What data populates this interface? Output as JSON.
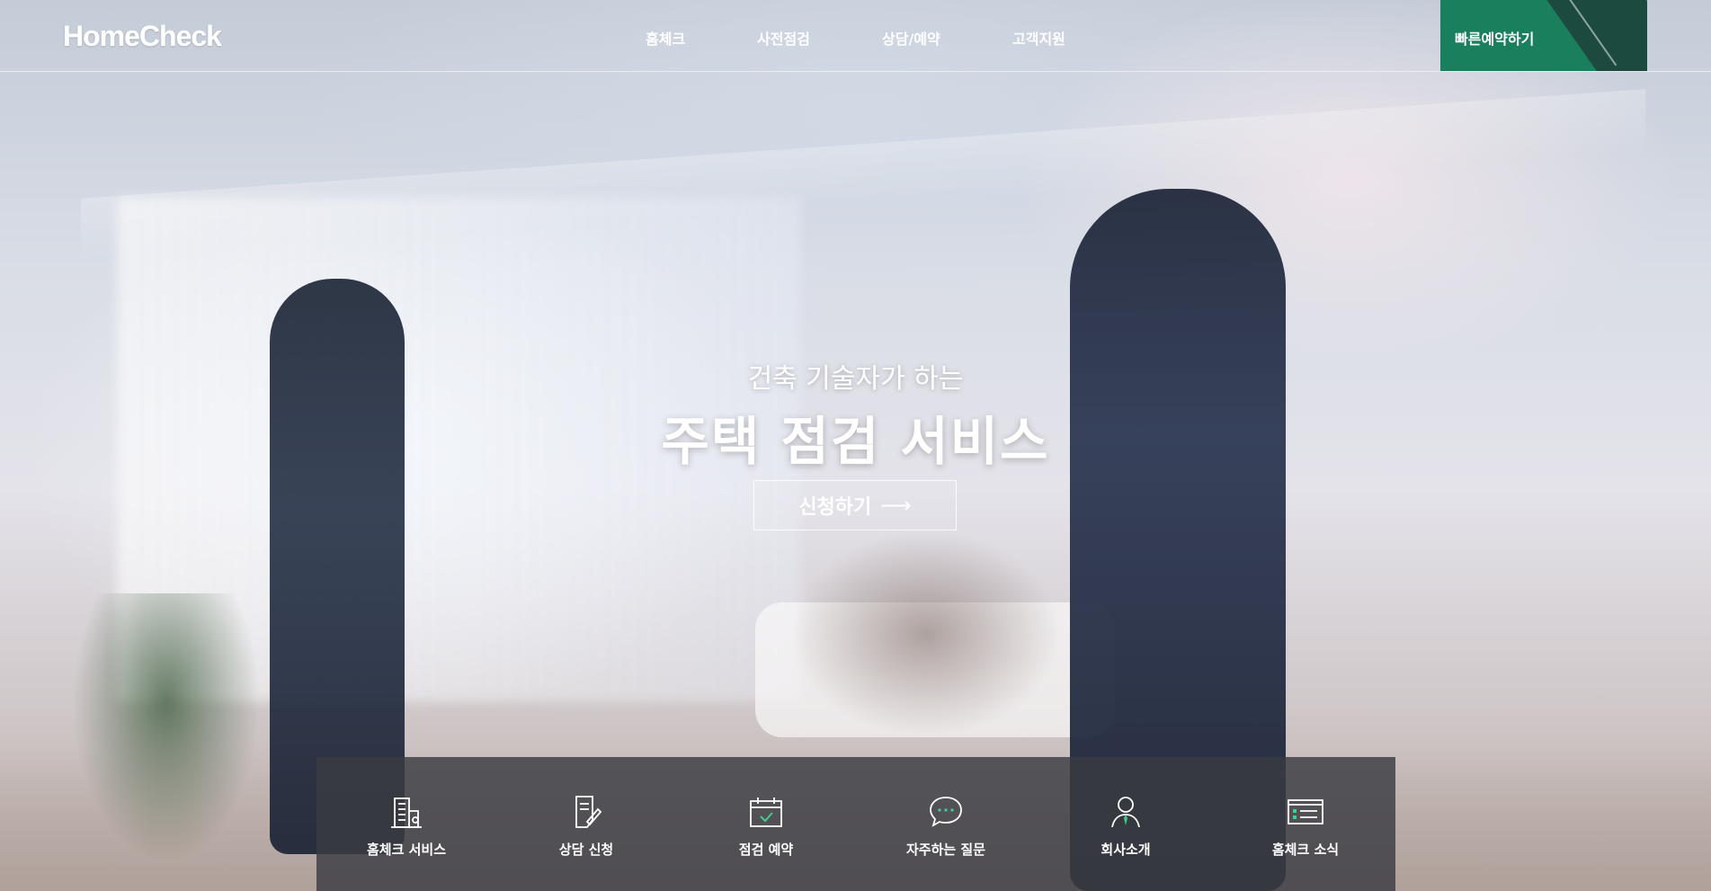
{
  "header": {
    "logo": "HomeCheck",
    "nav": [
      {
        "label": "홈체크"
      },
      {
        "label": "사전점검"
      },
      {
        "label": "상담/예약"
      },
      {
        "label": "고객지원"
      }
    ],
    "quick_reserve": "빠른예약하기",
    "accent_color": "#1a7f5c"
  },
  "hero": {
    "subtitle": "건축 기술자가 하는",
    "title": "주택 점검 서비스",
    "apply_label": "신청하기",
    "apply_arrow": "⟶"
  },
  "quick_menu": [
    {
      "label": "홈체크 서비스",
      "icon": "building-icon"
    },
    {
      "label": "상담 신청",
      "icon": "document-pen-icon"
    },
    {
      "label": "점검 예약",
      "icon": "calendar-check-icon"
    },
    {
      "label": "자주하는 질문",
      "icon": "chat-bubble-icon"
    },
    {
      "label": "회사소개",
      "icon": "person-icon"
    },
    {
      "label": "홈체크 소식",
      "icon": "news-list-icon"
    }
  ]
}
